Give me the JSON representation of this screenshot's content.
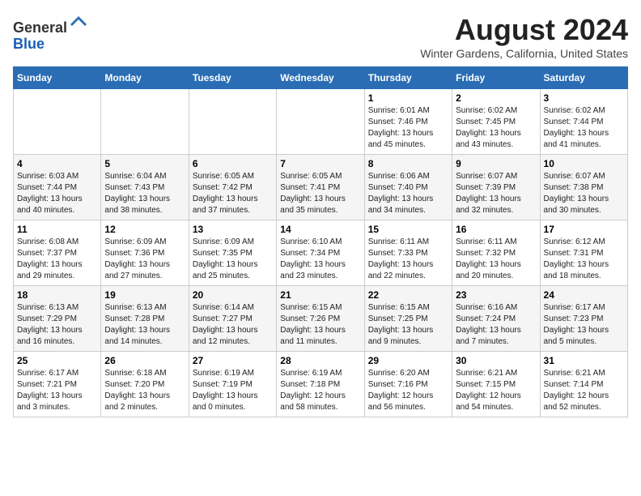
{
  "logo": {
    "general": "General",
    "blue": "Blue"
  },
  "header": {
    "title": "August 2024",
    "subtitle": "Winter Gardens, California, United States"
  },
  "days_of_week": [
    "Sunday",
    "Monday",
    "Tuesday",
    "Wednesday",
    "Thursday",
    "Friday",
    "Saturday"
  ],
  "weeks": [
    [
      {
        "day": "",
        "info": ""
      },
      {
        "day": "",
        "info": ""
      },
      {
        "day": "",
        "info": ""
      },
      {
        "day": "",
        "info": ""
      },
      {
        "day": "1",
        "info": "Sunrise: 6:01 AM\nSunset: 7:46 PM\nDaylight: 13 hours\nand 45 minutes."
      },
      {
        "day": "2",
        "info": "Sunrise: 6:02 AM\nSunset: 7:45 PM\nDaylight: 13 hours\nand 43 minutes."
      },
      {
        "day": "3",
        "info": "Sunrise: 6:02 AM\nSunset: 7:44 PM\nDaylight: 13 hours\nand 41 minutes."
      }
    ],
    [
      {
        "day": "4",
        "info": "Sunrise: 6:03 AM\nSunset: 7:44 PM\nDaylight: 13 hours\nand 40 minutes."
      },
      {
        "day": "5",
        "info": "Sunrise: 6:04 AM\nSunset: 7:43 PM\nDaylight: 13 hours\nand 38 minutes."
      },
      {
        "day": "6",
        "info": "Sunrise: 6:05 AM\nSunset: 7:42 PM\nDaylight: 13 hours\nand 37 minutes."
      },
      {
        "day": "7",
        "info": "Sunrise: 6:05 AM\nSunset: 7:41 PM\nDaylight: 13 hours\nand 35 minutes."
      },
      {
        "day": "8",
        "info": "Sunrise: 6:06 AM\nSunset: 7:40 PM\nDaylight: 13 hours\nand 34 minutes."
      },
      {
        "day": "9",
        "info": "Sunrise: 6:07 AM\nSunset: 7:39 PM\nDaylight: 13 hours\nand 32 minutes."
      },
      {
        "day": "10",
        "info": "Sunrise: 6:07 AM\nSunset: 7:38 PM\nDaylight: 13 hours\nand 30 minutes."
      }
    ],
    [
      {
        "day": "11",
        "info": "Sunrise: 6:08 AM\nSunset: 7:37 PM\nDaylight: 13 hours\nand 29 minutes."
      },
      {
        "day": "12",
        "info": "Sunrise: 6:09 AM\nSunset: 7:36 PM\nDaylight: 13 hours\nand 27 minutes."
      },
      {
        "day": "13",
        "info": "Sunrise: 6:09 AM\nSunset: 7:35 PM\nDaylight: 13 hours\nand 25 minutes."
      },
      {
        "day": "14",
        "info": "Sunrise: 6:10 AM\nSunset: 7:34 PM\nDaylight: 13 hours\nand 23 minutes."
      },
      {
        "day": "15",
        "info": "Sunrise: 6:11 AM\nSunset: 7:33 PM\nDaylight: 13 hours\nand 22 minutes."
      },
      {
        "day": "16",
        "info": "Sunrise: 6:11 AM\nSunset: 7:32 PM\nDaylight: 13 hours\nand 20 minutes."
      },
      {
        "day": "17",
        "info": "Sunrise: 6:12 AM\nSunset: 7:31 PM\nDaylight: 13 hours\nand 18 minutes."
      }
    ],
    [
      {
        "day": "18",
        "info": "Sunrise: 6:13 AM\nSunset: 7:29 PM\nDaylight: 13 hours\nand 16 minutes."
      },
      {
        "day": "19",
        "info": "Sunrise: 6:13 AM\nSunset: 7:28 PM\nDaylight: 13 hours\nand 14 minutes."
      },
      {
        "day": "20",
        "info": "Sunrise: 6:14 AM\nSunset: 7:27 PM\nDaylight: 13 hours\nand 12 minutes."
      },
      {
        "day": "21",
        "info": "Sunrise: 6:15 AM\nSunset: 7:26 PM\nDaylight: 13 hours\nand 11 minutes."
      },
      {
        "day": "22",
        "info": "Sunrise: 6:15 AM\nSunset: 7:25 PM\nDaylight: 13 hours\nand 9 minutes."
      },
      {
        "day": "23",
        "info": "Sunrise: 6:16 AM\nSunset: 7:24 PM\nDaylight: 13 hours\nand 7 minutes."
      },
      {
        "day": "24",
        "info": "Sunrise: 6:17 AM\nSunset: 7:23 PM\nDaylight: 13 hours\nand 5 minutes."
      }
    ],
    [
      {
        "day": "25",
        "info": "Sunrise: 6:17 AM\nSunset: 7:21 PM\nDaylight: 13 hours\nand 3 minutes."
      },
      {
        "day": "26",
        "info": "Sunrise: 6:18 AM\nSunset: 7:20 PM\nDaylight: 13 hours\nand 2 minutes."
      },
      {
        "day": "27",
        "info": "Sunrise: 6:19 AM\nSunset: 7:19 PM\nDaylight: 13 hours\nand 0 minutes."
      },
      {
        "day": "28",
        "info": "Sunrise: 6:19 AM\nSunset: 7:18 PM\nDaylight: 12 hours\nand 58 minutes."
      },
      {
        "day": "29",
        "info": "Sunrise: 6:20 AM\nSunset: 7:16 PM\nDaylight: 12 hours\nand 56 minutes."
      },
      {
        "day": "30",
        "info": "Sunrise: 6:21 AM\nSunset: 7:15 PM\nDaylight: 12 hours\nand 54 minutes."
      },
      {
        "day": "31",
        "info": "Sunrise: 6:21 AM\nSunset: 7:14 PM\nDaylight: 12 hours\nand 52 minutes."
      }
    ]
  ]
}
